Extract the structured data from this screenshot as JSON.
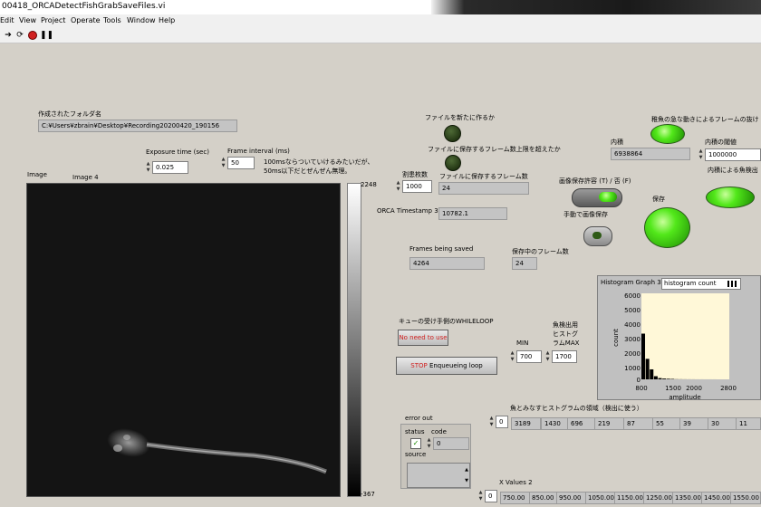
{
  "window": {
    "title": "00418_ORCADetectFishGrabSaveFiles.vi"
  },
  "menu": [
    "Edit",
    "View",
    "Project",
    "Operate",
    "Tools",
    "Window",
    "Help"
  ],
  "folder": {
    "label": "作成されたフォルダ名",
    "value": "C:¥Users¥zbrain¥Desktop¥Recording20200420_190156"
  },
  "image": {
    "label": "Image",
    "inner_label": "Image 4",
    "scale_max": "2248",
    "scale_min": "-367"
  },
  "exposure": {
    "label": "Exposure time (sec)",
    "value": "0.025"
  },
  "frame_interval": {
    "label": "Frame interval (ms)",
    "value": "50",
    "note1": "100msならついていけるみたいだが、",
    "note2": "50ms以下だとぜんぜん無理。"
  },
  "new_file": {
    "label": "ファイルを新たに作るか"
  },
  "exceed": {
    "label": "ファイルに保存するフレーム数上限を超えたか"
  },
  "split": {
    "label": "割患枚数",
    "value": "1000"
  },
  "frames_in_file": {
    "label": "ファイルに保存するフレーム数",
    "value": "24"
  },
  "timestamp": {
    "label": "ORCA Timestamp 3",
    "value": "10782.1"
  },
  "frames_being_saved": {
    "label": "Frames being saved",
    "value": "4264"
  },
  "frames_saving": {
    "label": "保存中のフレーム数",
    "value": "24"
  },
  "fast_move": {
    "label": "稚魚の急な動きによるフレームの抜け"
  },
  "inner_product": {
    "label": "内積",
    "value": "6938864"
  },
  "threshold": {
    "label": "内積の閾値",
    "value": "1000000"
  },
  "detect": {
    "label": "内積による魚検出"
  },
  "save_allow": {
    "label": "画像保存許容 (T) / 否 (F)"
  },
  "manual_save": {
    "label": "手動で画像保存"
  },
  "save": {
    "label": "保存"
  },
  "queue": {
    "label": "キューの受け手側のWHILELOOP",
    "button": "No need to use"
  },
  "stop": {
    "stop_word": "STOP",
    "rest": "Enqueueing loop"
  },
  "min": {
    "label": "MIN",
    "value": "700"
  },
  "max": {
    "label1": "魚検出用",
    "label2": "ヒストグ",
    "label3": "ラムMAX",
    "value": "1700"
  },
  "histogram": {
    "title": "Histogram Graph 3",
    "legend": "histogram count",
    "ylabel": "count",
    "xlabel": "amplitude",
    "yticks": [
      "6000",
      "5000",
      "4000",
      "3000",
      "2000",
      "1000",
      "0"
    ],
    "xticks": [
      "800",
      "1500",
      "2000",
      "2800"
    ]
  },
  "fish_range": {
    "label": "魚とみなすヒストグラムの領域（検出に使う）",
    "index": "0",
    "values": [
      "3189",
      "1430",
      "696",
      "219",
      "87",
      "55",
      "39",
      "30",
      "11"
    ]
  },
  "error_out": {
    "label": "error out",
    "status": "status",
    "code_label": "code",
    "code": "0",
    "source": "source"
  },
  "xvalues": {
    "label": "X Values 2",
    "index": "0",
    "values": [
      "750.00",
      "850.00",
      "950.00",
      "1050.00",
      "1150.00",
      "1250.00",
      "1350.00",
      "1450.00",
      "1550.00"
    ]
  },
  "chart_data": {
    "type": "bar",
    "title": "Histogram Graph 3",
    "xlabel": "amplitude",
    "ylabel": "count",
    "x": [
      750,
      850,
      950,
      1050,
      1150,
      1250,
      1350,
      1450,
      1550,
      1650,
      1750,
      1850,
      1950,
      2050,
      2150,
      2250,
      2350,
      2450,
      2550,
      2650,
      2750
    ],
    "values": [
      3189,
      1430,
      696,
      219,
      87,
      55,
      39,
      30,
      11,
      8,
      6,
      4,
      3,
      2,
      2,
      1,
      1,
      1,
      0,
      0,
      0
    ],
    "xlim": [
      700,
      2800
    ],
    "ylim": [
      0,
      6000
    ],
    "colors": {
      "bars": "#000000",
      "plot_bg": "#fff8d8"
    }
  }
}
